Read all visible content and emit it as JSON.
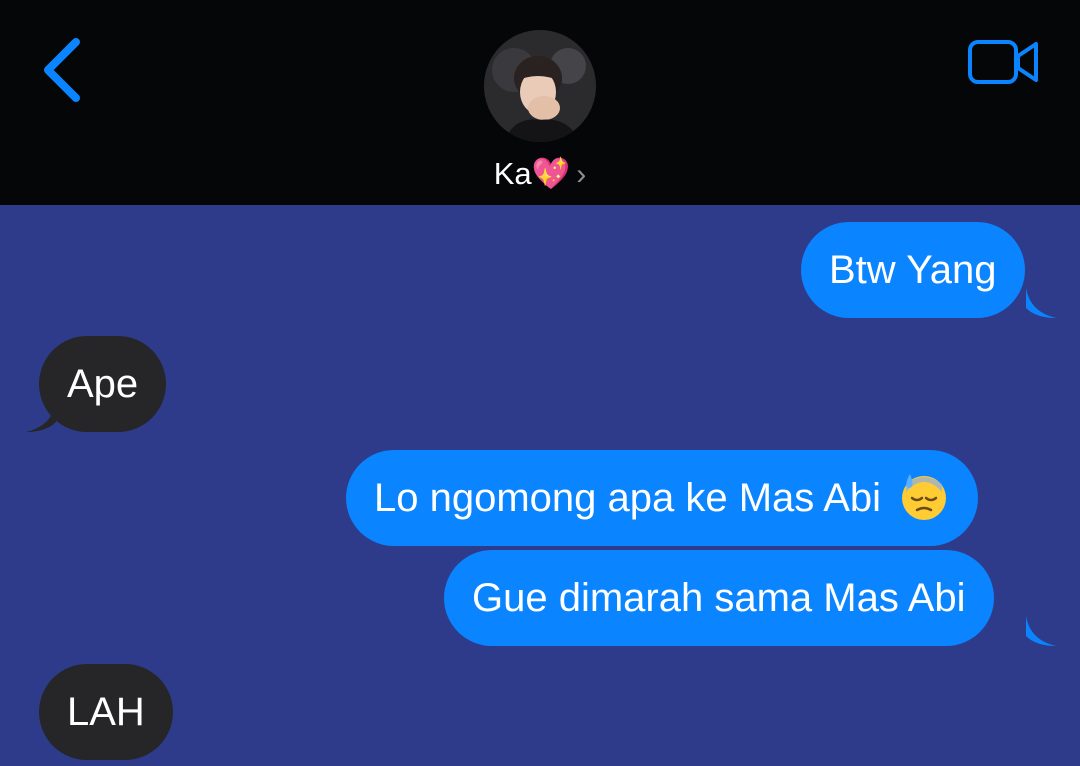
{
  "header": {
    "contact_name": "Ka💖",
    "chevron": "›",
    "icons": {
      "back": "chevron-left-icon",
      "video": "video-camera-icon"
    },
    "accent_color": "#0a84ff"
  },
  "messages": [
    {
      "direction": "sent",
      "text": "Btw Yang"
    },
    {
      "direction": "received",
      "text": "Ape"
    },
    {
      "direction": "sent",
      "text": "Lo ngomong apa ke Mas Abi",
      "emoji": "downcast-face-with-sweat-emoji"
    },
    {
      "direction": "sent",
      "text": "Gue dimarah sama Mas Abi"
    },
    {
      "direction": "received",
      "text": "LAH"
    }
  ],
  "colors": {
    "sent_bubble": "#0a84ff",
    "received_bubble": "#262628",
    "thread_background": "#2e3b8a",
    "header_background": "#050608"
  }
}
